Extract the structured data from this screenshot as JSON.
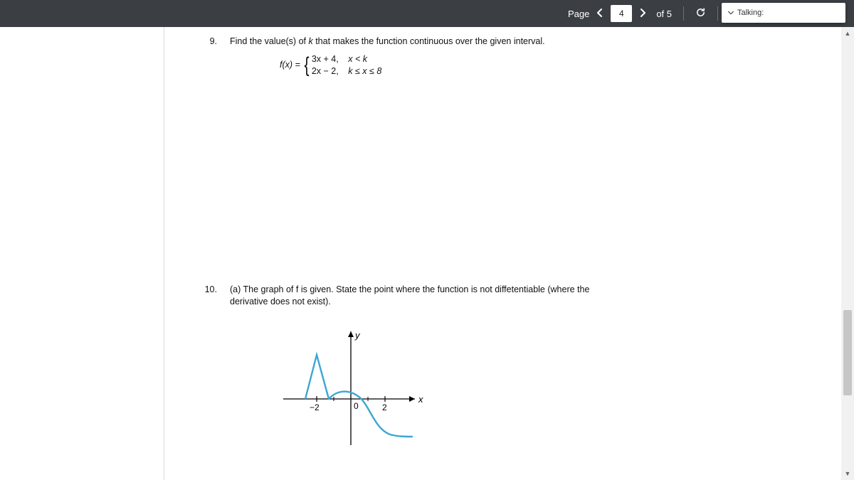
{
  "toolbar": {
    "page_label": "Page",
    "current_page": "4",
    "of_label": "of 5"
  },
  "talking": {
    "label": "Talking:"
  },
  "q9": {
    "number": "9.",
    "prompt_before_k": "Find the value(s) of ",
    "k": "k",
    "prompt_after_k": " that makes the function continuous over the given interval.",
    "fx_label": "f(x) = ",
    "row1_expr": "3x + 4,",
    "row1_cond": "x < k",
    "row2_expr": "2x − 2,",
    "row2_cond": "k ≤ x ≤ 8"
  },
  "q10": {
    "number": "10.",
    "prompt": "(a) The graph of f is given. State the point where the function is not diffetentiable (where the derivative does not exist).",
    "axis_y": "y",
    "axis_x": "x",
    "tick_neg2": "−2",
    "tick_0": "0",
    "tick_2": "2"
  },
  "chart_data": {
    "type": "line",
    "title": "",
    "xlabel": "x",
    "ylabel": "y",
    "xlim": [
      -4,
      4
    ],
    "ylim": [
      -3,
      3
    ],
    "ticks_x": [
      -2,
      0,
      2
    ],
    "series": [
      {
        "name": "f",
        "description": "Piecewise: sharp corner cusp near x = -2 rising to a peak; smooth curve descending through origin, crossing x-axis just right of 0, concave bend around x = 2, leveling off toward lower right.",
        "points_estimated": [
          {
            "x": -2.7,
            "y": 0.0
          },
          {
            "x": -2.0,
            "y": 2.6
          },
          {
            "x": -1.3,
            "y": 0.0
          },
          {
            "x": 0.0,
            "y": 0.4
          },
          {
            "x": 0.6,
            "y": 0.0
          },
          {
            "x": 2.0,
            "y": -1.8
          },
          {
            "x": 3.5,
            "y": -2.2
          }
        ]
      }
    ]
  }
}
